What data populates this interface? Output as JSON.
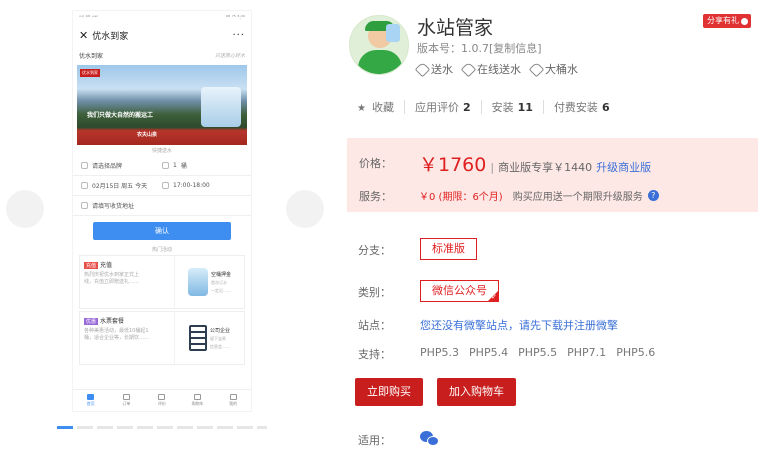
{
  "phone": {
    "status_left": "ᵛᵒˡ ⁴ᴳ ⁺ᵃⁿ",
    "status_right": "ᴷᴮ ⁷⁵ ³:⁰⁰",
    "close_icon": "✕",
    "title": "优水到家",
    "menu": "···",
    "brand": "优水到家",
    "slogan": "只送放心好水",
    "banner_logo": "优水到家",
    "banner_tagline": "我们只做大自然的搬运工",
    "banner_sub": "农夫山泉",
    "section_label": "快捷送水",
    "brand_select": "请选择品牌",
    "quantity": "1",
    "quantity_unit": "桶",
    "date": "02月15日 周五 今天",
    "time": "17:00-18:00",
    "address_placeholder": "请填写收货地址",
    "confirm": "确认",
    "activity_label": "热门活动",
    "card1": {
      "badge": "充值",
      "title": "充值",
      "desc1": "热烈庆祝优水到家正式上",
      "desc2": "线，充值立即赠送礼……",
      "right_title": "空桶押金",
      "right_desc1": "首次订水",
      "right_desc2": "一定记……"
    },
    "card2": {
      "badge": "优惠",
      "title": "水票套餐",
      "desc1": "各种美惠活动，最低10桶起1",
      "desc2": "桶，适合企业等，长期饮……",
      "right_title": "公司企业",
      "right_desc1": "留下宝贵",
      "right_desc2": "信息会……"
    },
    "tabs": [
      "首页",
      "订单",
      "评价",
      "购物车",
      "我的"
    ]
  },
  "app": {
    "name": "水站管家",
    "share_badge": "分享有礼",
    "version": "版本号：1.0.7[复制信息]",
    "tags": [
      "送水",
      "在线送水",
      "大桶水"
    ]
  },
  "stats": {
    "star": "★",
    "favorite": "收藏",
    "rating_label": "应用评价",
    "rating_value": "2",
    "install_label": "安装",
    "install_value": "11",
    "paid_label": "付费安装",
    "paid_value": "6"
  },
  "pricing": {
    "price_label": "价格：",
    "price": "￥1760",
    "pipe": "|",
    "business_price": "商业版专享￥1440",
    "upgrade": "升级商业版",
    "service_label": "服务：",
    "service_value": "￥0 (期限：6个月)",
    "service_note": "购买应用送一个期限升级服务",
    "help": "?"
  },
  "details": {
    "branch_label": "分支：",
    "branch_option": "标准版",
    "category_label": "类别：",
    "category_option": "微信公众号",
    "check": "✓",
    "site_label": "站点：",
    "site_link": "您还没有微擎站点，请先下载并注册微擎",
    "support_label": "支持：",
    "php_versions": [
      "PHP5.3",
      "PHP5.4",
      "PHP5.5",
      "PHP7.1",
      "PHP5.6"
    ],
    "apply_label": "适用："
  },
  "actions": {
    "buy": "立即购买",
    "cart": "加入购物车"
  },
  "colors": {
    "accent_red": "#e02020",
    "link_blue": "#3a6fd8",
    "price_bg": "#fde8e6",
    "phone_blue": "#3d8ef0"
  }
}
